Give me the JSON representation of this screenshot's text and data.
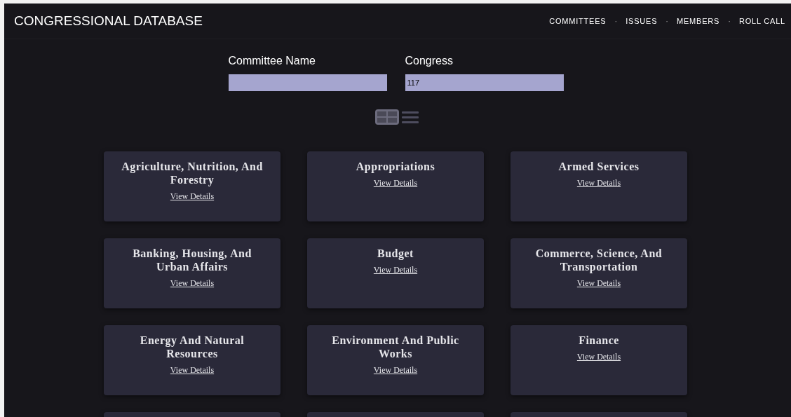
{
  "header": {
    "title": "CONGRESSIONAL DATABASE",
    "nav": [
      "COMMITTEES",
      "ISSUES",
      "MEMBERS",
      "ROLL CALL"
    ],
    "separator": "·"
  },
  "filters": [
    {
      "label": "Committee Name"
    },
    {
      "label": "Congress",
      "value": "117"
    }
  ],
  "view_toggle": [
    {
      "kind": "grid",
      "selected": true
    },
    {
      "kind": "list",
      "selected": false
    }
  ],
  "committees": [
    {
      "name": "Agriculture, Nutrition, And Forestry",
      "link": "View Details"
    },
    {
      "name": "Appropriations",
      "link": "View Details"
    },
    {
      "name": "Armed Services",
      "link": "View Details"
    },
    {
      "name": "Banking, Housing, And Urban Affairs",
      "link": "View Details"
    },
    {
      "name": "Budget",
      "link": "View Details"
    },
    {
      "name": "Commerce, Science, And Transportation",
      "link": "View Details"
    },
    {
      "name": "Energy And Natural Resources",
      "link": "View Details"
    },
    {
      "name": "Environment And Public Works",
      "link": "View Details"
    },
    {
      "name": "Finance",
      "link": "View Details"
    }
  ]
}
